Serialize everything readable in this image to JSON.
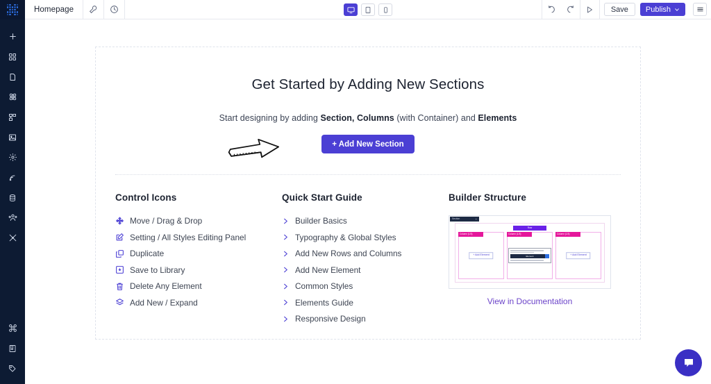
{
  "sidebar": {
    "logo_name": "app-logo",
    "items": [
      {
        "name": "add-new",
        "icon": "plus-icon"
      },
      {
        "name": "layouts",
        "icon": "grid-icon"
      },
      {
        "name": "pages",
        "icon": "page-icon"
      },
      {
        "name": "templates",
        "icon": "atom-icon"
      },
      {
        "name": "structure",
        "icon": "sitemap-icon"
      },
      {
        "name": "media",
        "icon": "image-icon"
      },
      {
        "name": "settings",
        "icon": "gear-icon"
      },
      {
        "name": "integrations",
        "icon": "broadcast-icon"
      },
      {
        "name": "database",
        "icon": "database-icon"
      },
      {
        "name": "users",
        "icon": "users-icon"
      },
      {
        "name": "tools",
        "icon": "tools-icon"
      }
    ],
    "bottom_items": [
      {
        "name": "shortcuts",
        "icon": "command-icon"
      },
      {
        "name": "documentation",
        "icon": "book-icon"
      },
      {
        "name": "history",
        "icon": "tag-icon"
      }
    ]
  },
  "topbar": {
    "page_tab": "Homepage",
    "tools": [
      {
        "name": "page-settings",
        "icon": "wrench-icon"
      },
      {
        "name": "revision-history",
        "icon": "clock-icon"
      }
    ],
    "devices": [
      {
        "name": "desktop-view",
        "icon": "desktop-icon",
        "active": true
      },
      {
        "name": "tablet-view",
        "icon": "tablet-icon",
        "active": false
      },
      {
        "name": "mobile-view",
        "icon": "mobile-icon",
        "active": false
      }
    ],
    "actions": [
      {
        "name": "undo",
        "icon": "undo-icon"
      },
      {
        "name": "redo",
        "icon": "redo-icon"
      },
      {
        "name": "preview",
        "icon": "play-icon"
      }
    ],
    "save_label": "Save",
    "publish_label": "Publish",
    "menu_icon": "hamburger-icon",
    "accent_color": "#4b3fd4"
  },
  "hero": {
    "title": "Get Started by Adding New Sections",
    "subtitle_1": "Start designing by adding ",
    "subtitle_bold_1": "Section, Columns",
    "subtitle_2": " (with Container) and ",
    "subtitle_bold_2": "Elements",
    "cta_label": "+ Add New Section",
    "arrow_icon": "hand-drawn-arrow-icon"
  },
  "control_icons": {
    "title": "Control Icons",
    "items": [
      {
        "label": "Move / Drag & Drop",
        "icon": "move-icon"
      },
      {
        "label": "Setting / All Styles Editing Panel",
        "icon": "edit-pencil-icon"
      },
      {
        "label": "Duplicate",
        "icon": "duplicate-icon"
      },
      {
        "label": "Save to Library",
        "icon": "save-floppy-icon"
      },
      {
        "label": "Delete Any Element",
        "icon": "trash-icon"
      },
      {
        "label": "Add New / Expand",
        "icon": "layers-icon"
      }
    ]
  },
  "quick_start": {
    "title": "Quick Start Guide",
    "items": [
      {
        "label": "Builder Basics",
        "icon": "chevron-right-icon"
      },
      {
        "label": "Typography & Global Styles",
        "icon": "chevron-right-icon"
      },
      {
        "label": "Add New Rows and Columns",
        "icon": "chevron-right-icon"
      },
      {
        "label": "Add New Element",
        "icon": "chevron-right-icon"
      },
      {
        "label": "Common Styles",
        "icon": "chevron-right-icon"
      },
      {
        "label": "Elements Guide",
        "icon": "chevron-right-icon"
      },
      {
        "label": "Responsive Design",
        "icon": "chevron-right-icon"
      }
    ]
  },
  "builder_structure": {
    "title": "Builder Structure",
    "diagram": {
      "section_label": "Section",
      "section_plus": "+",
      "row_label": "Row",
      "column_labels": [
        "Column (1/3)",
        "Column (1/3)",
        "Column (1/3)"
      ],
      "add_element_label": "+ Add Element",
      "element_label": "Element"
    },
    "doc_link": "View in Documentation"
  },
  "chat": {
    "name": "support-chat",
    "icon": "chat-bubble-icon"
  }
}
